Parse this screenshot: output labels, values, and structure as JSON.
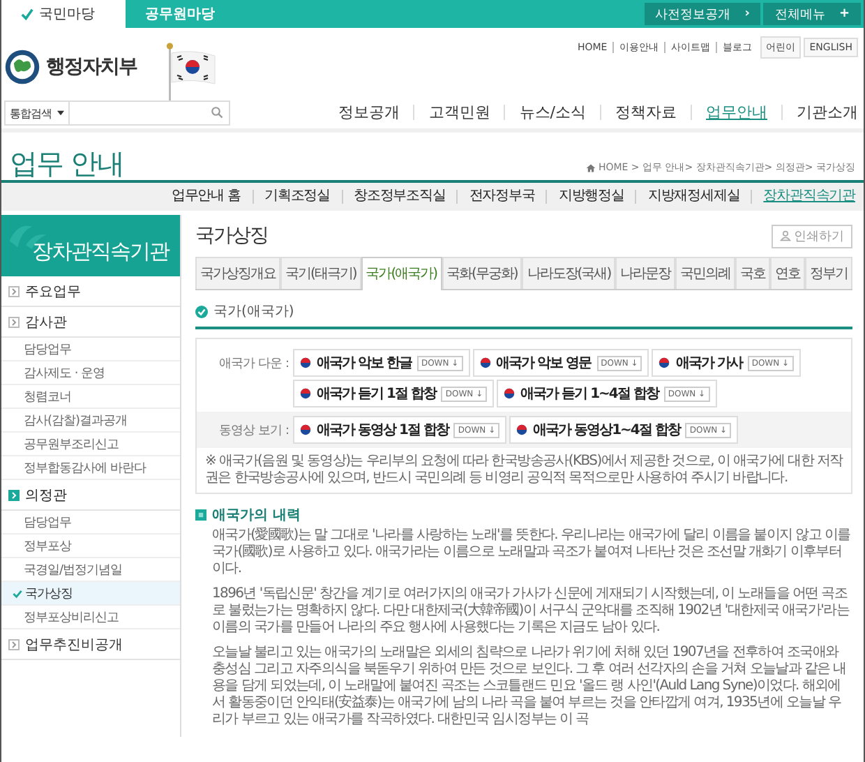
{
  "top_bar": {
    "tabs": [
      {
        "label": "국민마당",
        "selected": true
      },
      {
        "label": "공무원마당",
        "selected": false
      }
    ],
    "buttons": [
      {
        "label": "사전정보공개",
        "icon": "›"
      },
      {
        "label": "전체메뉴",
        "icon": "+"
      }
    ]
  },
  "site": {
    "name": "행정자치부"
  },
  "utility_links": [
    "HOME",
    "이용안내",
    "사이트맵",
    "블로그"
  ],
  "utility_buttons": [
    "어린이",
    "ENGLISH"
  ],
  "search": {
    "scope": "통합검색"
  },
  "main_nav": [
    {
      "label": "정보공개",
      "selected": false
    },
    {
      "label": "고객민원",
      "selected": false
    },
    {
      "label": "뉴스/소식",
      "selected": false
    },
    {
      "label": "정책자료",
      "selected": false
    },
    {
      "label": "업무안내",
      "selected": true
    },
    {
      "label": "기관소개",
      "selected": false
    }
  ],
  "page_title": "업무 안내",
  "breadcrumb": "HOME > 업무 안내> 장차관직속기관> 의정관> 국가상징",
  "sub_nav": [
    {
      "label": "업무안내 홈",
      "selected": false
    },
    {
      "label": "기획조정실",
      "selected": false
    },
    {
      "label": "창조정부조직실",
      "selected": false
    },
    {
      "label": "전자정부국",
      "selected": false
    },
    {
      "label": "지방행정실",
      "selected": false
    },
    {
      "label": "지방재정세제실",
      "selected": false
    },
    {
      "label": "장차관직속기관",
      "selected": true
    }
  ],
  "sidebar": {
    "title": "장차관직속기관",
    "items": [
      {
        "label": "주요업무",
        "selected": false
      },
      {
        "label": "감사관",
        "selected": false,
        "children": [
          {
            "label": "담당업무",
            "selected": false
          },
          {
            "label": "감사제도 · 운영",
            "selected": false
          },
          {
            "label": "청렴코너",
            "selected": false
          },
          {
            "label": "감사(감찰)결과공개",
            "selected": false
          },
          {
            "label": "공무원부조리신고",
            "selected": false
          },
          {
            "label": "정부합동감사에 바란다",
            "selected": false
          }
        ]
      },
      {
        "label": "의정관",
        "selected": true,
        "children": [
          {
            "label": "담당업무",
            "selected": false
          },
          {
            "label": "정부포상",
            "selected": false
          },
          {
            "label": "국경일/법정기념일",
            "selected": false
          },
          {
            "label": "국가상징",
            "selected": true
          },
          {
            "label": "정부포상비리신고",
            "selected": false
          }
        ]
      },
      {
        "label": "업무추진비공개",
        "selected": false
      }
    ]
  },
  "content": {
    "title": "국가상징",
    "print_button": "인쇄하기",
    "tabs": [
      {
        "label": "국가상징개요",
        "selected": false
      },
      {
        "label": "국기(태극기)",
        "selected": false
      },
      {
        "label": "국가(애국가)",
        "selected": true
      },
      {
        "label": "국화(무궁화)",
        "selected": false
      },
      {
        "label": "나라도장(국새)",
        "selected": false
      },
      {
        "label": "나라문장",
        "selected": false
      },
      {
        "label": "국민의례",
        "selected": false
      },
      {
        "label": "국호",
        "selected": false
      },
      {
        "label": "연호",
        "selected": false
      },
      {
        "label": "정부기",
        "selected": false
      }
    ],
    "section_title": "국가(애국가)",
    "download_groups": [
      {
        "label": "애국가 다운 :",
        "shaded": false,
        "links": [
          {
            "title": "애국가 악보 한글",
            "action": "DOWN ↓"
          },
          {
            "title": "애국가 악보 영문",
            "action": "DOWN ↓"
          },
          {
            "title": "애국가 가사",
            "action": "DOWN ↓"
          },
          {
            "title": "애국가 듣기 1절 합창",
            "action": "DOWN ↓"
          },
          {
            "title": "애국가 듣기 1~4절 합창",
            "action": "DOWN ↓"
          }
        ]
      },
      {
        "label": "동영상 보기 :",
        "shaded": true,
        "links": [
          {
            "title": "애국가 동영상 1절 합창",
            "action": "DOWN ↓"
          },
          {
            "title": "애국가 동영상1~4절 합창",
            "action": "DOWN ↓"
          }
        ]
      }
    ],
    "notice": "※ 애국가(음원 및 동영상)는 우리부의 요청에 따라 한국방송공사(KBS)에서 제공한 것으로, 이 애국가에 대한 저작권은 한국방송공사에 있으며, 반드시 국민의례 등 비영리 공익적 목적으로만 사용하여 주시기 바랍니다.",
    "history": {
      "title": "애국가의 내력",
      "paragraphs": [
        "애국가(愛國歌)는 말 그대로 '나라를 사랑하는 노래'를 뜻한다. 우리나라는 애국가에 달리 이름을 붙이지 않고 이를 국가(國歌)로 사용하고 있다. 애국가라는 이름으로 노래말과 곡조가 붙여져 나타난 것은 조선말 개화기 이후부터이다.",
        "1896년 '독립신문' 창간을 계기로 여러가지의 애국가 가사가 신문에 게재되기 시작했는데, 이 노래들을 어떤 곡조로 불렀는가는 명확하지 않다. 다만 대한제국(大韓帝國)이 서구식 군악대를 조직해 1902년 '대한제국 애국가'라는 이름의 국가를 만들어 나라의 주요 행사에 사용했다는 기록은 지금도 남아 있다.",
        "오늘날 불리고 있는 애국가의 노래말은 외세의 침략으로 나라가 위기에 처해 있던 1907년을 전후하여 조국애와 충성심 그리고 자주의식을 북돋우기 위하여 만든 것으로 보인다. 그 후 여러 선각자의 손을 거쳐 오늘날과 같은 내용을 담게 되었는데, 이 노래말에 붙여진 곡조는 스코틀랜드 민요 '올드 랭 사인'(Auld Lang Syne)이었다. 해외에서 활동중이던 안익태(安益泰)는 애국가에 남의 나라 곡을 붙여 부르는 것을 안타깝게 여겨, 1935년에 오늘날 우리가 부르고 있는 애국가를 작곡하였다. 대한민국 임시정부는 이 곡"
      ]
    }
  }
}
